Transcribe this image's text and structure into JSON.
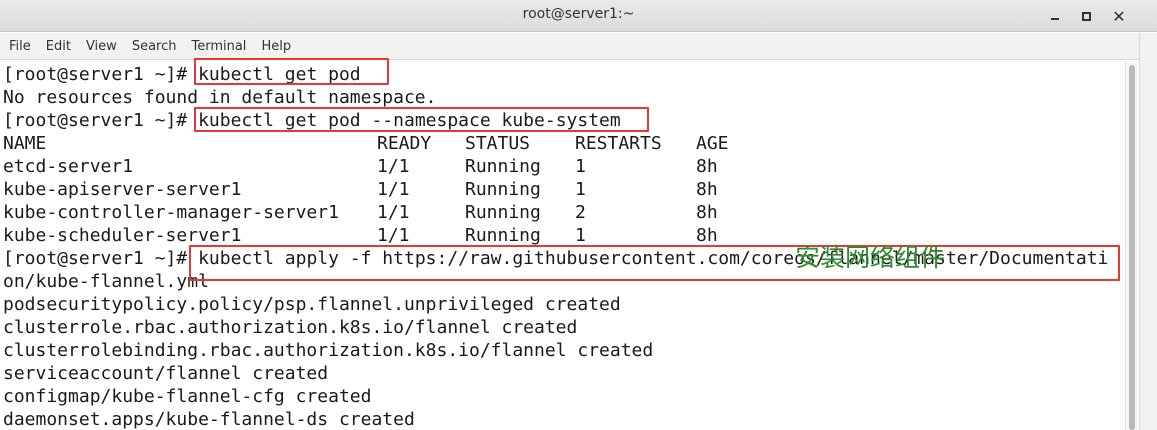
{
  "window": {
    "title": "root@server1:~",
    "controls": [
      "minimize",
      "maximize",
      "close"
    ]
  },
  "menu": [
    "File",
    "Edit",
    "View",
    "Search",
    "Terminal",
    "Help"
  ],
  "terminal": {
    "prompt": "[root@server1 ~]# ",
    "cmd1": "kubectl get pod",
    "out1": "No resources found in default namespace.",
    "cmd2": "kubectl get pod --namespace kube-system",
    "table": {
      "headers": [
        "NAME",
        "READY",
        "STATUS",
        "RESTARTS",
        "AGE"
      ],
      "rows": [
        [
          "etcd-server1",
          "1/1",
          "Running",
          "1",
          "8h"
        ],
        [
          "kube-apiserver-server1",
          "1/1",
          "Running",
          "1",
          "8h"
        ],
        [
          "kube-controller-manager-server1",
          "1/1",
          "Running",
          "2",
          "8h"
        ],
        [
          "kube-scheduler-server1",
          "1/1",
          "Running",
          "1",
          "8h"
        ]
      ]
    },
    "cmd3": "kubectl apply -f https://raw.githubusercontent.com/coreos/flannel/master/Documentati",
    "cmd3_wrap": "on/kube-flannel.yml",
    "outputs": [
      "podsecuritypolicy.policy/psp.flannel.unprivileged created",
      "clusterrole.rbac.authorization.k8s.io/flannel created",
      "clusterrolebinding.rbac.authorization.k8s.io/flannel created",
      "serviceaccount/flannel created",
      "configmap/kube-flannel-cfg created",
      "daemonset.apps/kube-flannel-ds created"
    ]
  },
  "annotation": {
    "text": "安装网络组件",
    "color": "#2e8b2e"
  },
  "highlight_color": "#e53935"
}
